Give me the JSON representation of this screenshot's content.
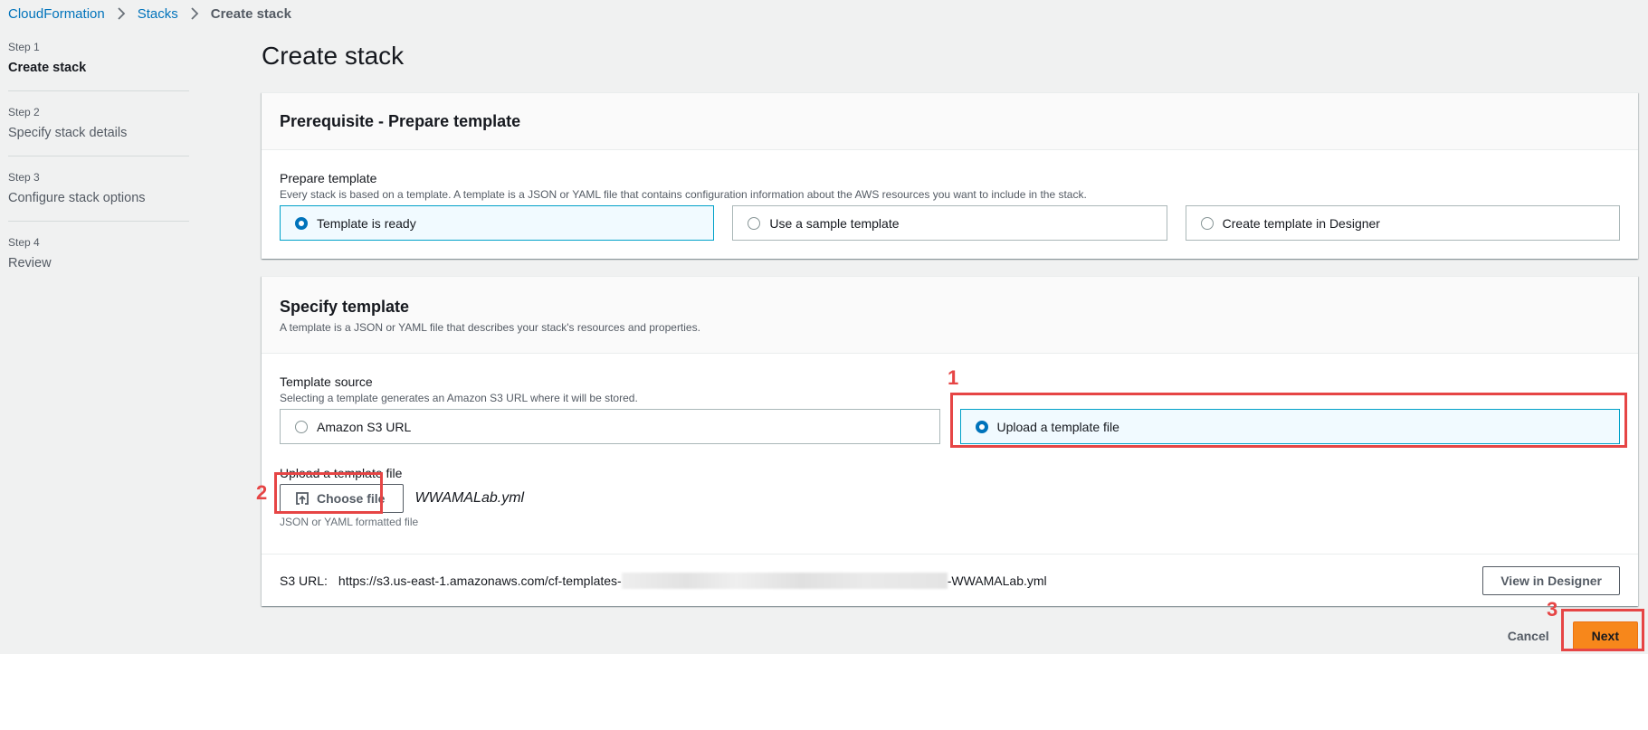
{
  "breadcrumb": {
    "items": [
      "CloudFormation",
      "Stacks"
    ],
    "current": "Create stack"
  },
  "steps": [
    {
      "num": "Step 1",
      "title": "Create stack",
      "active": true
    },
    {
      "num": "Step 2",
      "title": "Specify stack details",
      "active": false
    },
    {
      "num": "Step 3",
      "title": "Configure stack options",
      "active": false
    },
    {
      "num": "Step 4",
      "title": "Review",
      "active": false
    }
  ],
  "page_title": "Create stack",
  "prerequisite": {
    "title": "Prerequisite - Prepare template",
    "field_label": "Prepare template",
    "field_desc": "Every stack is based on a template. A template is a JSON or YAML file that contains configuration information about the AWS resources you want to include in the stack.",
    "options": [
      {
        "label": "Template is ready",
        "selected": true
      },
      {
        "label": "Use a sample template",
        "selected": false
      },
      {
        "label": "Create template in Designer",
        "selected": false
      }
    ]
  },
  "specify": {
    "title": "Specify template",
    "desc": "A template is a JSON or YAML file that describes your stack's resources and properties.",
    "source_label": "Template source",
    "source_desc": "Selecting a template generates an Amazon S3 URL where it will be stored.",
    "options": [
      {
        "label": "Amazon S3 URL",
        "selected": false
      },
      {
        "label": "Upload a template file",
        "selected": true
      }
    ],
    "upload_label": "Upload a template file",
    "choose_file_label": "Choose file",
    "filename": "WWAMALab.yml",
    "upload_hint": "JSON or YAML formatted file",
    "s3_label": "S3 URL:",
    "s3_prefix": "https://s3.us-east-1.amazonaws.com/cf-templates-",
    "s3_suffix": "-WWAMALab.yml",
    "view_designer_label": "View in Designer"
  },
  "actions": {
    "cancel_label": "Cancel",
    "next_label": "Next"
  },
  "annotations": [
    "1",
    "2",
    "3"
  ],
  "colors": {
    "link": "#0073bb",
    "primary": "#f7871b",
    "selected_border": "#00a1c9",
    "selected_bg": "#f1faff",
    "annotation": "#e64545"
  }
}
